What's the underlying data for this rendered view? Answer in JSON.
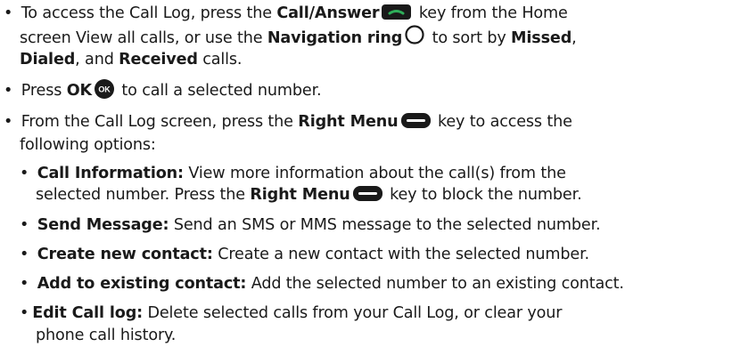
{
  "bullets": {
    "b1": {
      "t1": "To access the Call Log, press the ",
      "call_answer": "Call/Answer",
      "t2": " key from the Home",
      "t3": "screen View all calls, or use the ",
      "nav_ring": "Navigation ring",
      "t4": " to sort by ",
      "missed": "Missed",
      "comma": ",",
      "dialed": "Dialed",
      "t5": ", and ",
      "received": "Received",
      "t6": " calls."
    },
    "b2": {
      "t1": "Press ",
      "ok": "OK",
      "ok_icon_text": "OK",
      "t2": " to call a selected number."
    },
    "b3": {
      "t1": "From the Call Log screen, press the ",
      "right_menu": "Right Menu",
      "t2": " key to access the",
      "t3": "following options:"
    }
  },
  "options": {
    "call_info": {
      "label": "Call Information:",
      "t1": " View more information about the call(s) from the",
      "t2": "selected number. Press the ",
      "right_menu": "Right Menu",
      "t3": " key to block the number."
    },
    "send_message": {
      "label": "Send Message:",
      "t1": " Send an SMS or MMS message to the selected number."
    },
    "create_contact": {
      "label": "Create new contact:",
      "t1": " Create a new contact with the selected number."
    },
    "add_existing": {
      "label": "Add to existing contact:",
      "t1": " Add the selected number to an existing contact."
    },
    "edit_log": {
      "label": "Edit Call log:",
      "t1": " Delete selected calls from your Call Log, or clear your",
      "t2": "phone call history."
    }
  },
  "bullet_char": "•",
  "colors": {
    "text": "#1a1a1a",
    "key_body": "#1a1a1a",
    "call_key_accent": "#2fae5a"
  },
  "icons": [
    "call-answer-key-icon",
    "navigation-ring-icon",
    "ok-key-icon",
    "right-menu-key-icon"
  ]
}
